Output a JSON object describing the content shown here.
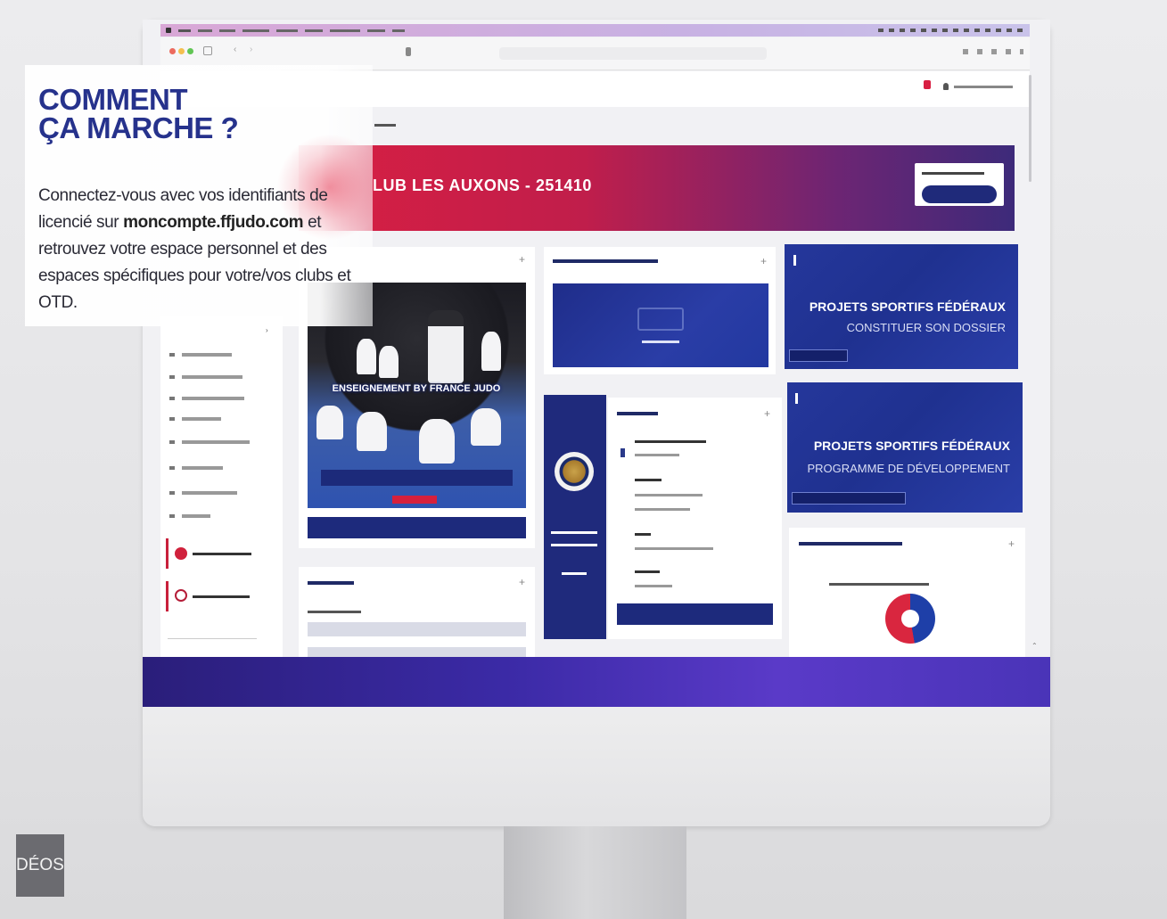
{
  "overlay": {
    "title_line1": "COMMENT",
    "title_line2": "ÇA MARCHE ?",
    "body_part1": "Connectez-vous avec vos identifiants de licencié sur ",
    "body_link": "moncompte.ffjudo.com",
    "body_part2": " et retrouvez votre espace personnel et des espaces spécifiques pour votre/vos clubs et OTD."
  },
  "side_tab": {
    "label": "DÉOS"
  },
  "website": {
    "banner_title": "LUB LES AUXONS - 251410",
    "photo_banner": "ENSEIGNEMENT BY FRANCE JUDO",
    "pp_cards": [
      {
        "title": "PROJETS SPORTIFS FÉDÉRAUX",
        "subtitle": "CONSTITUER SON DOSSIER"
      },
      {
        "title": "PROJETS SPORTIFS FÉDÉRAUX",
        "subtitle": "PROGRAMME DE DÉVELOPPEMENT"
      }
    ]
  },
  "colors": {
    "brand_navy": "#1d2a7c",
    "brand_red": "#d81f42",
    "overlay_title": "#26328c"
  }
}
